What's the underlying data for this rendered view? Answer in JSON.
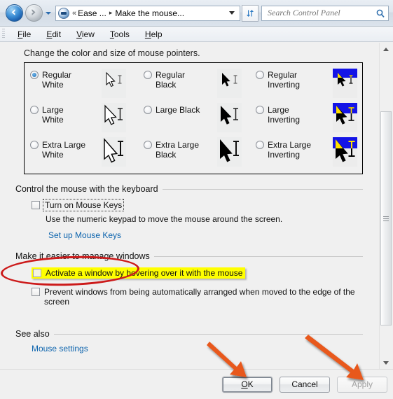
{
  "window": {
    "breadcrumb": {
      "overflow": "«",
      "first": "Ease ...",
      "separator": "▸",
      "current": "Make the mouse...",
      "cp_icon": "control-panel-icon",
      "dropdown_icon": "chevron-down-icon"
    },
    "nav": {
      "back_icon": "back-arrow-icon",
      "forward_icon": "forward-arrow-icon",
      "history_icon": "chevron-down-icon",
      "refresh_icon": "refresh-icon"
    },
    "search": {
      "placeholder": "Search Control Panel",
      "value": "",
      "icon": "search-icon"
    },
    "menu": [
      {
        "label": "File",
        "accel": "F"
      },
      {
        "label": "Edit",
        "accel": "E"
      },
      {
        "label": "View",
        "accel": "V"
      },
      {
        "label": "Tools",
        "accel": "T"
      },
      {
        "label": "Help",
        "accel": "H"
      }
    ]
  },
  "main": {
    "lead": "Change the color and size of mouse pointers.",
    "pointers": [
      {
        "id": "regular-white",
        "label": "Regular\nWhite",
        "selected": true,
        "style": "white"
      },
      {
        "id": "large-white",
        "label": "Large\nWhite",
        "selected": false,
        "style": "white"
      },
      {
        "id": "extra-large-white",
        "label": "Extra Large\nWhite",
        "selected": false,
        "style": "white"
      },
      {
        "id": "regular-black",
        "label": "Regular\nBlack",
        "selected": false,
        "style": "black"
      },
      {
        "id": "large-black",
        "label": "Large Black",
        "selected": false,
        "style": "black"
      },
      {
        "id": "extra-large-black",
        "label": "Extra Large\nBlack",
        "selected": false,
        "style": "black"
      },
      {
        "id": "regular-inverting",
        "label": "Regular\nInverting",
        "selected": false,
        "style": "inverting"
      },
      {
        "id": "large-inverting",
        "label": "Large\nInverting",
        "selected": false,
        "style": "inverting"
      },
      {
        "id": "extra-large-inverting",
        "label": "Extra Large\nInverting",
        "selected": false,
        "style": "inverting"
      }
    ],
    "keyboard_section": {
      "heading": "Control the mouse with the keyboard",
      "checkbox_label": "Turn on Mouse Keys",
      "checkbox_checked": false,
      "checkbox_focused": true,
      "hint": "Use the numeric keypad to move the mouse around the screen.",
      "link": "Set up Mouse Keys"
    },
    "windows_section": {
      "heading": "Make it easier to manage windows",
      "highlighted_checkbox_label": "Activate a window by hovering over it with the mouse",
      "highlighted_checkbox_checked": false,
      "second_checkbox_label": "Prevent windows from being automatically arranged when moved to the edge of the screen",
      "second_checkbox_checked": false
    },
    "see_also": {
      "heading": "See also",
      "link": "Mouse settings"
    },
    "scrollbar": {
      "up_icon": "scroll-up-icon",
      "down_icon": "scroll-down-icon",
      "thumb": "scrollbar-thumb"
    }
  },
  "buttons": {
    "ok": "OK",
    "cancel": "Cancel",
    "apply": "Apply",
    "apply_enabled": false
  },
  "annotations": {
    "ellipse_target": "Make it easier to manage windows",
    "arrow_1_target": "OK",
    "arrow_2_target": "Apply",
    "color": "#e8581c",
    "ellipse_color": "#cc1a1a",
    "highlight_color": "#ffff00"
  }
}
